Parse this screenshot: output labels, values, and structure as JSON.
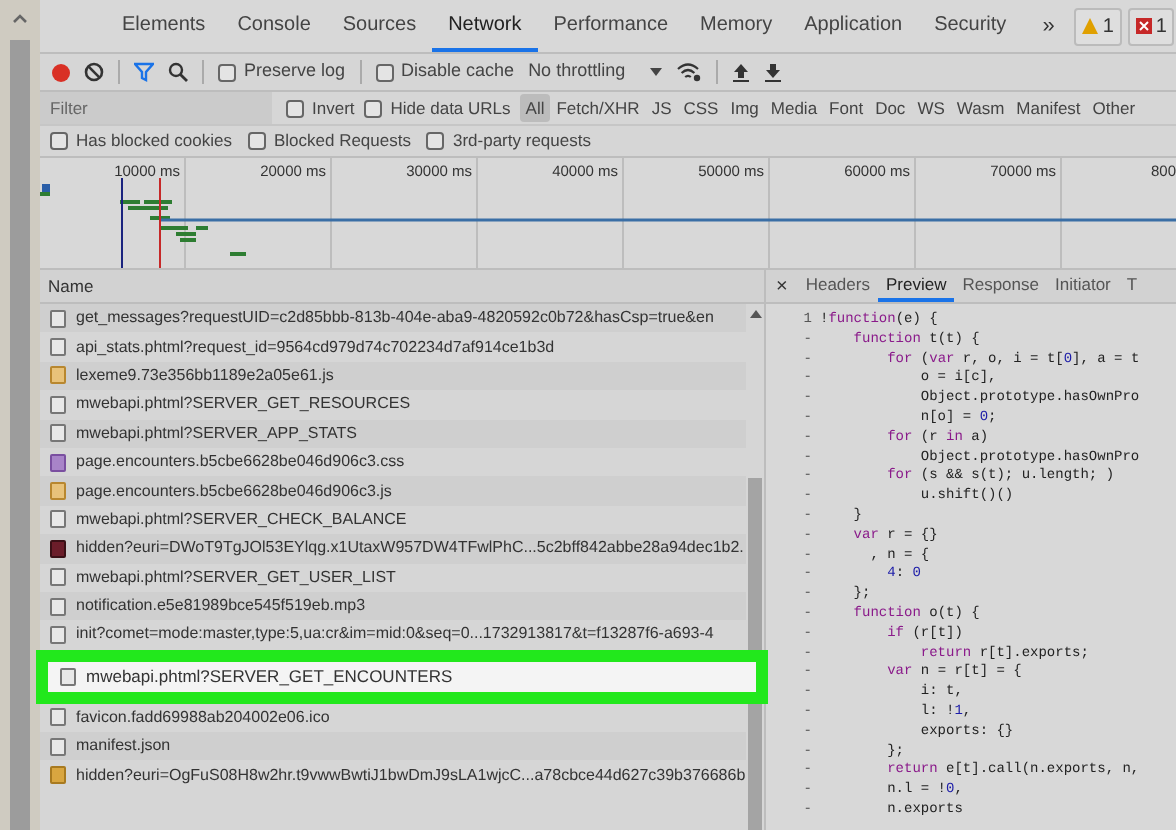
{
  "main_tabs": [
    {
      "label": "Elements",
      "selected": false
    },
    {
      "label": "Console",
      "selected": false
    },
    {
      "label": "Sources",
      "selected": false
    },
    {
      "label": "Network",
      "selected": true
    },
    {
      "label": "Performance",
      "selected": false
    },
    {
      "label": "Memory",
      "selected": false
    },
    {
      "label": "Application",
      "selected": false
    },
    {
      "label": "Security",
      "selected": false
    }
  ],
  "more_tabs": "»",
  "badges": [
    {
      "kind": "warning",
      "count": "1"
    },
    {
      "kind": "error",
      "count": "1"
    }
  ],
  "toolbar": {
    "recording": true,
    "preserve_log": {
      "label": "Preserve log",
      "checked": false
    },
    "disable_cache": {
      "label": "Disable cache",
      "checked": false
    },
    "throttling": "No throttling"
  },
  "filter": {
    "placeholder": "Filter",
    "invert": {
      "label": "Invert",
      "checked": false
    },
    "hide_data_urls": {
      "label": "Hide data URLs",
      "checked": false
    },
    "types": [
      {
        "label": "All",
        "selected": true
      },
      {
        "label": "Fetch/XHR",
        "selected": false
      },
      {
        "label": "JS",
        "selected": false
      },
      {
        "label": "CSS",
        "selected": false
      },
      {
        "label": "Img",
        "selected": false
      },
      {
        "label": "Media",
        "selected": false
      },
      {
        "label": "Font",
        "selected": false
      },
      {
        "label": "Doc",
        "selected": false
      },
      {
        "label": "WS",
        "selected": false
      },
      {
        "label": "Wasm",
        "selected": false
      },
      {
        "label": "Manifest",
        "selected": false
      },
      {
        "label": "Other",
        "selected": false
      }
    ]
  },
  "more_filters": [
    {
      "label": "Has blocked cookies",
      "checked": false
    },
    {
      "label": "Blocked Requests",
      "checked": false
    },
    {
      "label": "3rd-party requests",
      "checked": false
    }
  ],
  "timeline": {
    "ticks": [
      "10000 ms",
      "20000 ms",
      "30000 ms",
      "40000 ms",
      "50000 ms",
      "60000 ms",
      "70000 ms",
      "800"
    ]
  },
  "requests": {
    "column": "Name",
    "rows": [
      {
        "name": "get_messages?requestUID=c2d85bbb-813b-404e-aba9-4820592c0b72&hasCsp=true&en",
        "kind": "doc",
        "highlighted": false
      },
      {
        "name": "api_stats.phtml?request_id=9564cd979d74c702234d7af914ce1b3d",
        "kind": "doc",
        "highlighted": false
      },
      {
        "name": "lexeme9.73e356bb1189e2a05e61.js",
        "kind": "script",
        "highlighted": false
      },
      {
        "name": "mwebapi.phtml?SERVER_GET_RESOURCES",
        "kind": "doc",
        "highlighted": false
      },
      {
        "name": "mwebapi.phtml?SERVER_APP_STATS",
        "kind": "doc",
        "highlighted": false
      },
      {
        "name": "page.encounters.b5cbe6628be046d906c3.css",
        "kind": "stylesheet",
        "highlighted": false
      },
      {
        "name": "page.encounters.b5cbe6628be046d906c3.js",
        "kind": "script",
        "highlighted": false
      },
      {
        "name": "mwebapi.phtml?SERVER_CHECK_BALANCE",
        "kind": "doc",
        "highlighted": false
      },
      {
        "name": "hidden?euri=DWoT9TgJOl53EYlqg.x1UtaxW957DW4TFwlPhC...5c2bff842abbe28a94dec1b2.",
        "kind": "image",
        "highlighted": false
      },
      {
        "name": "mwebapi.phtml?SERVER_GET_USER_LIST",
        "kind": "doc",
        "highlighted": false
      },
      {
        "name": "notification.e5e81989bce545f519eb.mp3",
        "kind": "doc",
        "highlighted": false
      },
      {
        "name": "init?comet=mode:master,type:5,ua:cr&im=mid:0&seq=0...1732913817&t=f13287f6-a693-4",
        "kind": "doc",
        "highlighted": false
      },
      {
        "name": "mwebapi.phtml?SERVER_GET_ENCOUNTERS",
        "kind": "doc",
        "highlighted": true
      },
      {
        "name": "favicon.fadd69988ab204002e06.ico",
        "kind": "doc",
        "highlighted": false
      },
      {
        "name": "manifest.json",
        "kind": "doc",
        "highlighted": false
      },
      {
        "name": "hidden?euri=OgFuS08H8w2hr.t9vwwBwtiJ1bwDmJ9sLA1wjcC...a78cbce44d627c39b376686b",
        "kind": "asset",
        "highlighted": false
      }
    ]
  },
  "detail_tabs": {
    "close": "×",
    "tabs": [
      {
        "label": "Headers",
        "selected": false
      },
      {
        "label": "Preview",
        "selected": true
      },
      {
        "label": "Response",
        "selected": false
      },
      {
        "label": "Initiator",
        "selected": false
      },
      {
        "label": "T",
        "selected": false
      }
    ]
  },
  "code": [
    {
      "number": "1",
      "segments": [
        {
          "text": "!",
          "kind": "plain"
        },
        {
          "text": "function",
          "kind": "keyword"
        },
        {
          "text": "(e) {",
          "kind": "plain"
        }
      ]
    },
    {
      "number": "-",
      "segments": [
        {
          "text": "    function",
          "kind": "keyword"
        },
        {
          "text": " t(t) {",
          "kind": "plain"
        }
      ]
    },
    {
      "number": "-",
      "segments": [
        {
          "text": "        for",
          "kind": "keyword"
        },
        {
          "text": " (",
          "kind": "plain"
        },
        {
          "text": "var",
          "kind": "keyword"
        },
        {
          "text": " r, o, i = t[",
          "kind": "plain"
        },
        {
          "text": "0",
          "kind": "number"
        },
        {
          "text": "], a = t",
          "kind": "plain"
        }
      ]
    },
    {
      "number": "-",
      "segments": [
        {
          "text": "            o = i[c],",
          "kind": "plain"
        }
      ]
    },
    {
      "number": "-",
      "segments": [
        {
          "text": "            Object.prototype.hasOwnPro",
          "kind": "plain"
        }
      ]
    },
    {
      "number": "-",
      "segments": [
        {
          "text": "            n[o] = ",
          "kind": "plain"
        },
        {
          "text": "0",
          "kind": "number"
        },
        {
          "text": ";",
          "kind": "plain"
        }
      ]
    },
    {
      "number": "-",
      "segments": [
        {
          "text": "        for",
          "kind": "keyword"
        },
        {
          "text": " (r ",
          "kind": "plain"
        },
        {
          "text": "in",
          "kind": "keyword"
        },
        {
          "text": " a)",
          "kind": "plain"
        }
      ]
    },
    {
      "number": "-",
      "segments": [
        {
          "text": "            Object.prototype.hasOwnPro",
          "kind": "plain"
        }
      ]
    },
    {
      "number": "-",
      "segments": [
        {
          "text": "        for",
          "kind": "keyword"
        },
        {
          "text": " (s && s(t); u.length; )",
          "kind": "plain"
        }
      ]
    },
    {
      "number": "-",
      "segments": [
        {
          "text": "            u.shift()()",
          "kind": "plain"
        }
      ]
    },
    {
      "number": "-",
      "segments": [
        {
          "text": "    }",
          "kind": "plain"
        }
      ]
    },
    {
      "number": "-",
      "segments": [
        {
          "text": "    var",
          "kind": "keyword"
        },
        {
          "text": " r = {}",
          "kind": "plain"
        }
      ]
    },
    {
      "number": "-",
      "segments": [
        {
          "text": "      , n = {",
          "kind": "plain"
        }
      ]
    },
    {
      "number": "-",
      "segments": [
        {
          "text": "        4",
          "kind": "number"
        },
        {
          "text": ": ",
          "kind": "plain"
        },
        {
          "text": "0",
          "kind": "number"
        }
      ]
    },
    {
      "number": "-",
      "segments": [
        {
          "text": "    };",
          "kind": "plain"
        }
      ]
    },
    {
      "number": "-",
      "segments": [
        {
          "text": "    function",
          "kind": "keyword"
        },
        {
          "text": " o(t) {",
          "kind": "plain"
        }
      ]
    },
    {
      "number": "-",
      "segments": [
        {
          "text": "        if",
          "kind": "keyword"
        },
        {
          "text": " (r[t])",
          "kind": "plain"
        }
      ]
    },
    {
      "number": "-",
      "segments": [
        {
          "text": "            return",
          "kind": "keyword"
        },
        {
          "text": " r[t].exports;",
          "kind": "plain"
        }
      ]
    },
    {
      "number": "-",
      "segments": [
        {
          "text": "        var",
          "kind": "keyword"
        },
        {
          "text": " n = r[t] = {",
          "kind": "plain"
        }
      ]
    },
    {
      "number": "-",
      "segments": [
        {
          "text": "            i: t,",
          "kind": "plain"
        }
      ]
    },
    {
      "number": "-",
      "segments": [
        {
          "text": "            l: !",
          "kind": "plain"
        },
        {
          "text": "1",
          "kind": "number"
        },
        {
          "text": ",",
          "kind": "plain"
        }
      ]
    },
    {
      "number": "-",
      "segments": [
        {
          "text": "            exports: {}",
          "kind": "plain"
        }
      ]
    },
    {
      "number": "-",
      "segments": [
        {
          "text": "        };",
          "kind": "plain"
        }
      ]
    },
    {
      "number": "-",
      "segments": [
        {
          "text": "        return",
          "kind": "keyword"
        },
        {
          "text": " e[t].call(n.exports, n,",
          "kind": "plain"
        }
      ]
    },
    {
      "number": "-",
      "segments": [
        {
          "text": "        n.l = !",
          "kind": "plain"
        },
        {
          "text": "0",
          "kind": "number"
        },
        {
          "text": ",",
          "kind": "plain"
        }
      ]
    },
    {
      "number": "-",
      "segments": [
        {
          "text": "        n.exports",
          "kind": "plain"
        }
      ]
    }
  ]
}
